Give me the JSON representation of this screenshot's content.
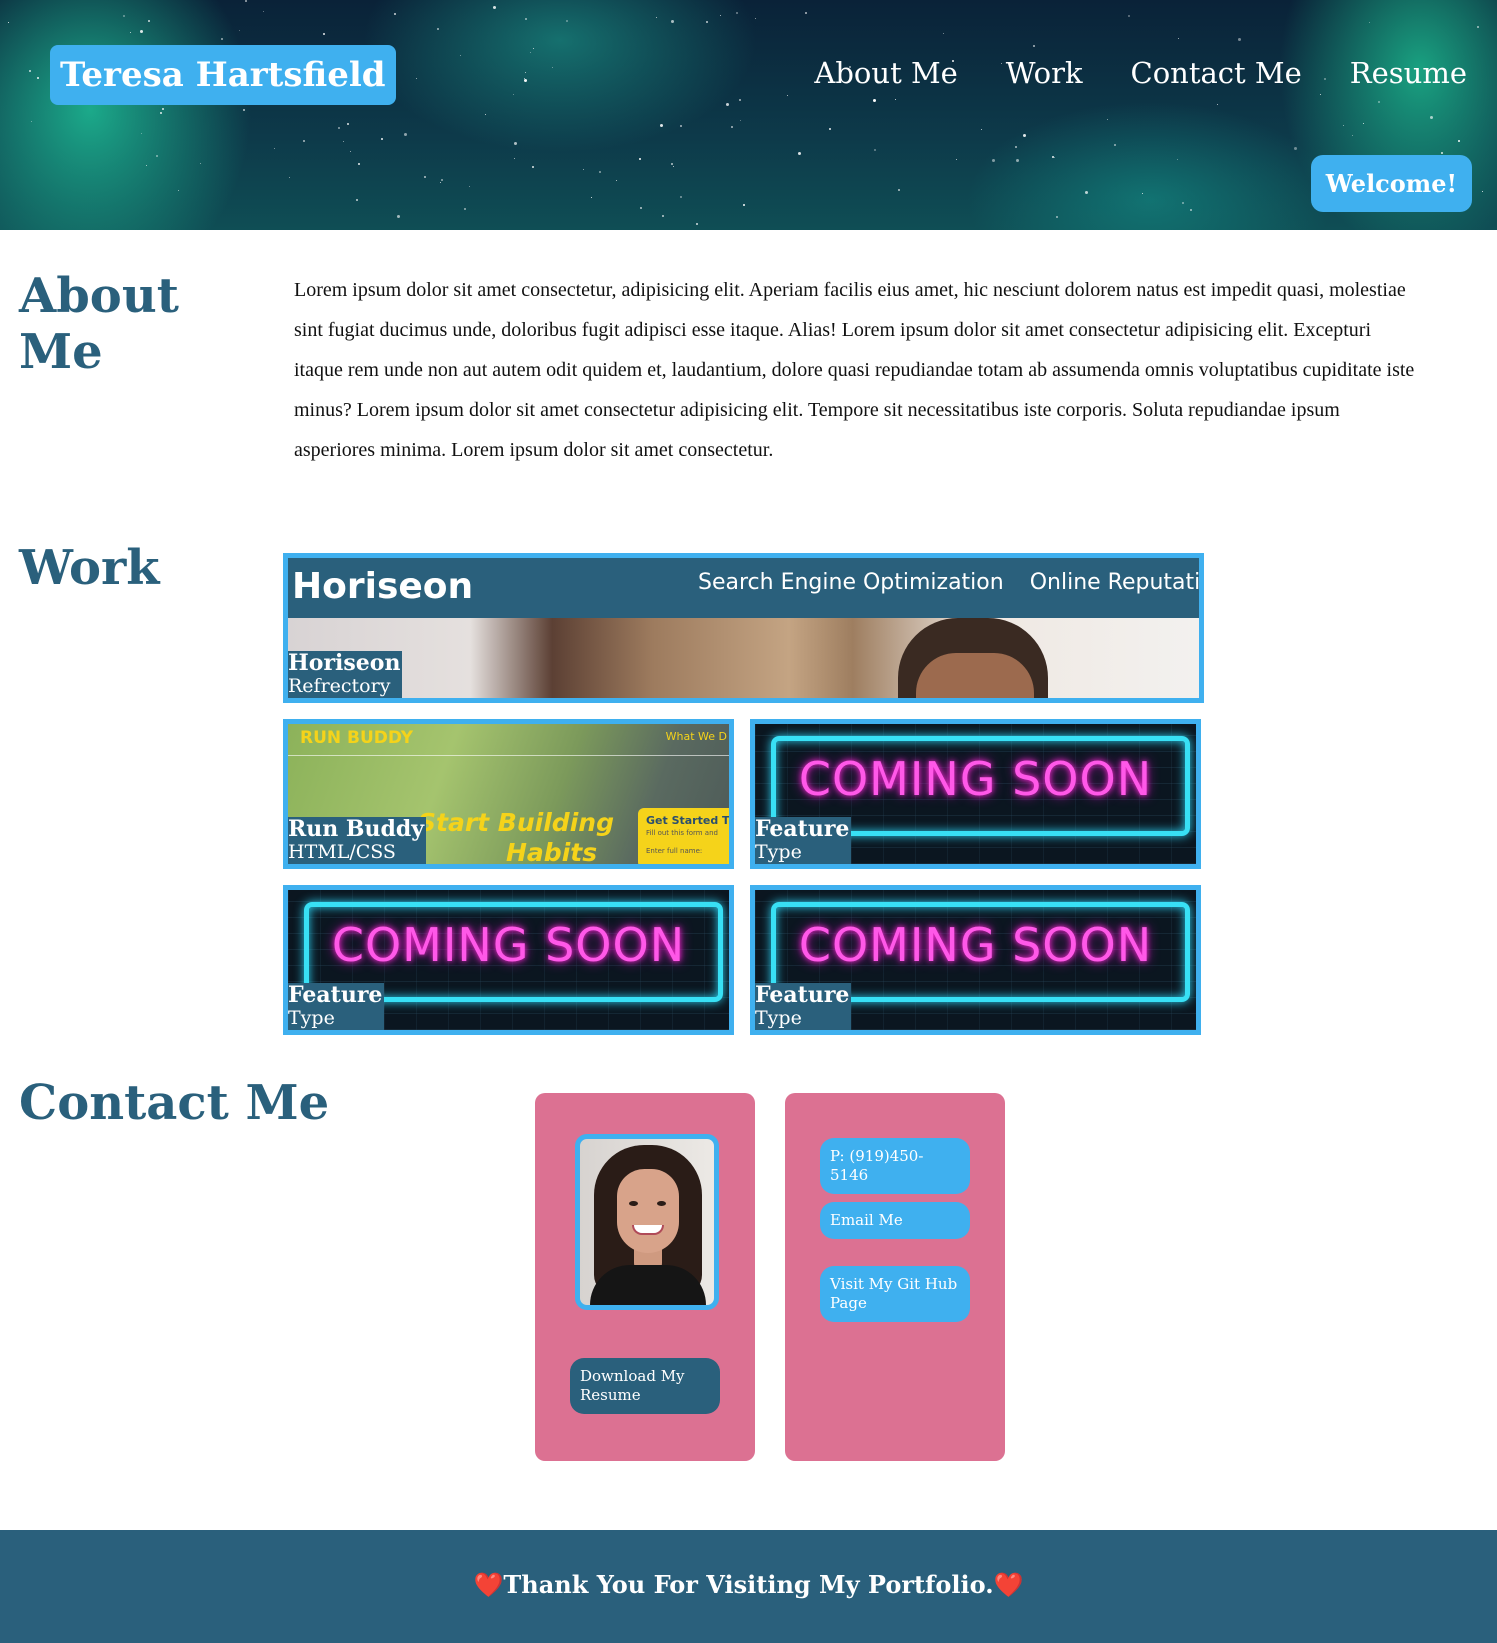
{
  "header": {
    "brand": "Teresa Hartsfield",
    "nav": [
      "About Me",
      "Work",
      "Contact Me",
      "Resume"
    ],
    "welcome": "Welcome!"
  },
  "about": {
    "title_line1": "About",
    "title_line2": "Me",
    "text": "Lorem ipsum dolor sit amet consectetur, adipisicing elit. Aperiam facilis eius amet, hic nesciunt dolorem natus est impedit quasi, molestiae sint fugiat ducimus unde, doloribus fugit adipisci esse itaque. Alias! Lorem ipsum dolor sit amet consectetur adipisicing elit. Excepturi itaque rem unde non aut autem odit quidem et, laudantium, dolore quasi repudiandae totam ab assumenda omnis voluptatibus cupiditate iste minus? Lorem ipsum dolor sit amet consectetur adipisicing elit. Tempore sit necessitatibus iste corporis. Soluta repudiandae ipsum asperiores minima. Lorem ipsum dolor sit amet consectetur."
  },
  "work": {
    "title": "Work",
    "featured": {
      "name": "Horiseon",
      "type": "Refrectory",
      "screenshot": {
        "logo": "Horiseon",
        "nav": [
          "Search Engine Optimization",
          "Online Reputation Ma"
        ]
      }
    },
    "projects": [
      {
        "name": "Run Buddy",
        "type": "HTML/CSS",
        "screenshot": {
          "logo": "RUN BUDDY",
          "nav": "What We D",
          "headline_1": "Start Building",
          "headline_2": "Habits",
          "card_title": "Get Started T",
          "card_sub": "Fill out this form and",
          "card_field": "Enter full name:"
        }
      },
      {
        "name": "Feature",
        "type": "Type",
        "banner": "COMING SOON"
      },
      {
        "name": "Feature",
        "type": "Type",
        "banner": "COMING SOON"
      },
      {
        "name": "Feature",
        "type": "Type",
        "banner": "COMING SOON"
      }
    ]
  },
  "contact": {
    "title": "Contact Me",
    "download_resume": "Download My Resume",
    "phone": "P: (919)450-5146",
    "email": "Email Me",
    "github": "Visit My Git Hub Page"
  },
  "footer": {
    "heart": "❤️",
    "text": "Thank You For Visiting My Portfolio."
  },
  "colors": {
    "accent_blue": "#3fb0ef",
    "navy": "#2a607c",
    "card_pink": "#dc7192"
  }
}
